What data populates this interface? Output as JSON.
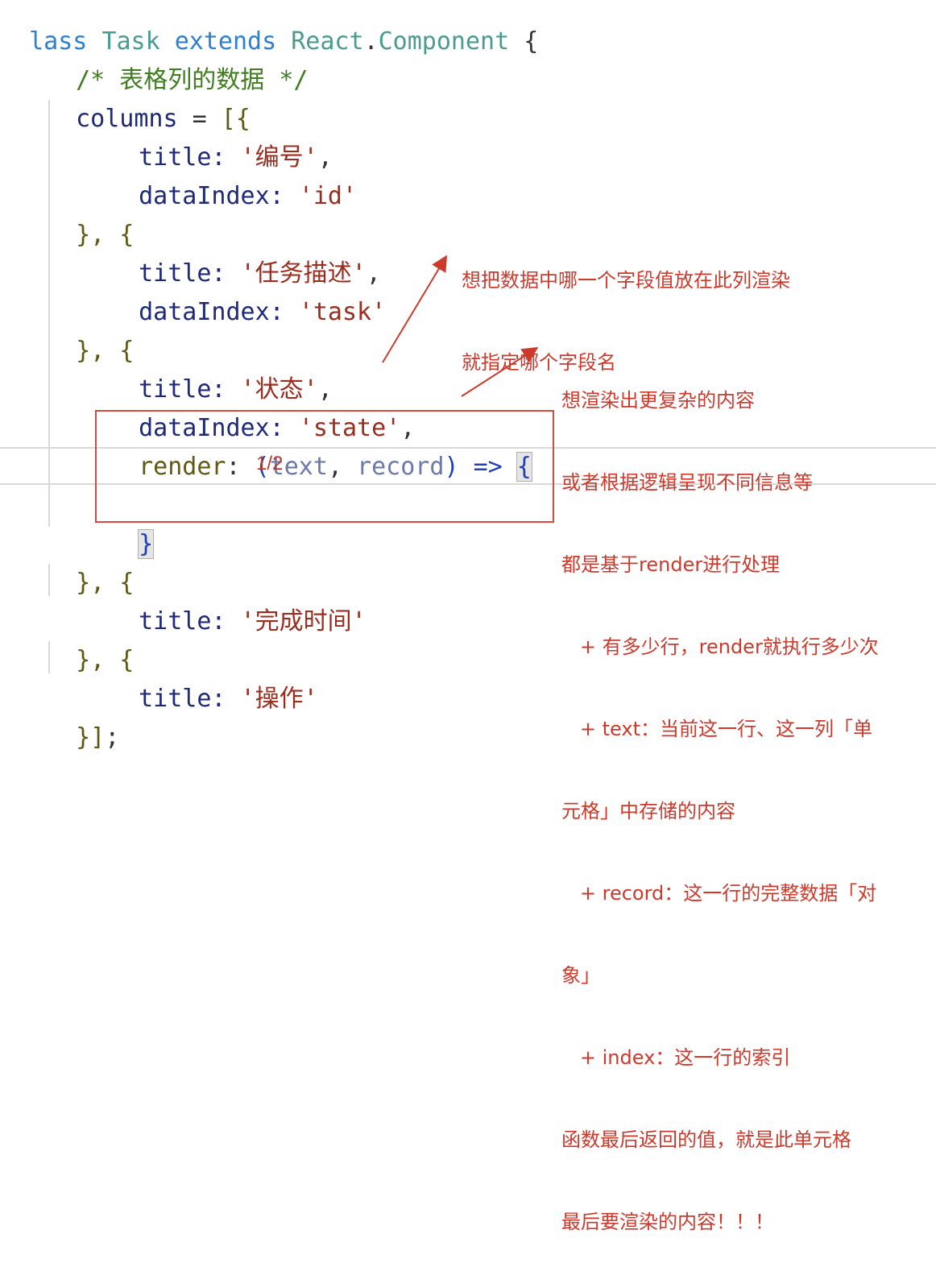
{
  "code": {
    "l1": {
      "kw1": "lass",
      "cls": "Task",
      "kw2": "extends",
      "sup": "React",
      "dot": ".",
      "comp": "Component",
      "brace": "{"
    },
    "l2": {
      "comment": "/* 表格列的数据 */"
    },
    "l3": {
      "name": "columns",
      "eq": "=",
      "open": "[{"
    },
    "l4": {
      "key": "title:",
      "val": "'编号'",
      "comma": ","
    },
    "l5": {
      "key": "dataIndex:",
      "val": "'id'"
    },
    "l6": {
      "text": "}, {"
    },
    "l7": {
      "key": "title:",
      "val": "'任务描述'",
      "comma": ","
    },
    "l8": {
      "key": "dataIndex:",
      "val": "'task'"
    },
    "l9": {
      "text": "}, {"
    },
    "l10": {
      "key": "title:",
      "val": "'状态'",
      "comma": ","
    },
    "l11": {
      "key": "dataIndex:",
      "val": "'state'",
      "comma": ","
    },
    "l12": {
      "fn": "render",
      "colon": ":",
      "po": "(",
      "p1": "text",
      "comma": ",",
      "p2": "record",
      "pc": ")",
      "arrow": "=>",
      "brace": "{"
    },
    "l14": {
      "brace": "}"
    },
    "l15": {
      "text": "}, {"
    },
    "l16": {
      "key": "title:",
      "val": "'完成时间'"
    },
    "l17": {
      "text": "}, {"
    },
    "l18": {
      "key": "title:",
      "val": "'操作'"
    },
    "l19": {
      "close": "}]",
      "semi": ";"
    }
  },
  "page_counter": "1/2",
  "annotations": {
    "top": [
      "想把数据中哪一个字段值放在此列渲染",
      "就指定哪个字段名"
    ],
    "right": [
      "想渲染出更复杂的内容",
      "或者根据逻辑呈现不同信息等",
      "都是基于render进行处理",
      "   + 有多少行，render就执行多少次",
      "   + text：当前这一行、这一列「单",
      "元格」中存储的内容",
      "   + record：这一行的完整数据「对",
      "象」",
      "   + index：这一行的索引",
      "函数最后返回的值，就是此单元格",
      "最后要渲染的内容！！！"
    ]
  },
  "colors": {
    "annotation": "#cc3a2c",
    "box": "#d34a3f",
    "string": "#9a2d1e",
    "comment": "#3f7d20"
  }
}
